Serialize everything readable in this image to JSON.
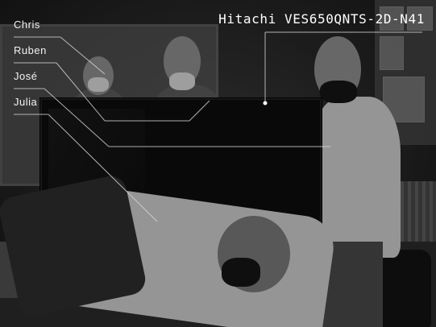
{
  "title": "Hitachi VES650QNTS-2D-N41",
  "names": [
    "Chris",
    "Ruben",
    "José",
    "Julia"
  ]
}
